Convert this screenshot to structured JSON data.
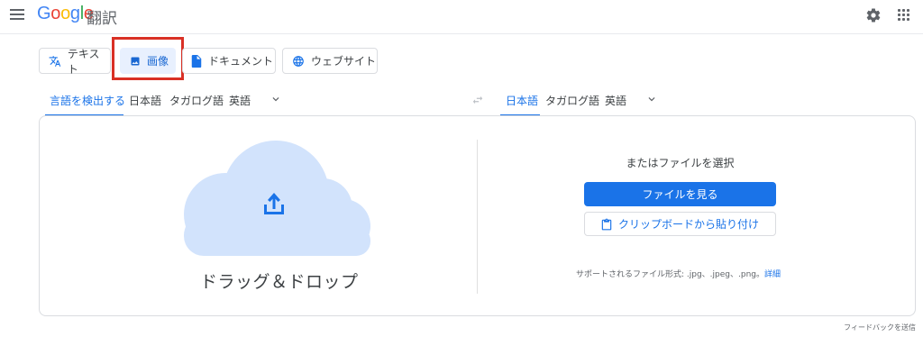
{
  "header": {
    "logo": [
      "G",
      "o",
      "o",
      "g",
      "l",
      "e"
    ],
    "product": "翻訳",
    "icons": [
      "menu-icon",
      "gear-icon",
      "apps-icon"
    ]
  },
  "modes": [
    {
      "label": "テキスト",
      "icon": "translate-icon"
    },
    {
      "label": "画像",
      "icon": "image-icon",
      "active": true
    },
    {
      "label": "ドキュメント",
      "icon": "document-icon"
    },
    {
      "label": "ウェブサイト",
      "icon": "globe-icon"
    }
  ],
  "source_langs": [
    "言語を検出する",
    "日本語",
    "タガログ語",
    "英語"
  ],
  "target_langs": [
    "日本語",
    "タガログ語",
    "英語"
  ],
  "upload": {
    "drop_label": "ドラッグ＆ドロップ",
    "or_select": "またはファイルを選択",
    "browse_button": "ファイルを見る",
    "clipboard_button": "クリップボードから貼り付け",
    "formats": "サポートされるファイル形式: .jpg、.jpeg、.png。",
    "details_link": "詳細"
  },
  "feedback": "フィードバックを送信",
  "colors": {
    "accent": "#1a73e8",
    "highlight": "#d93025",
    "cloud": "#d2e3fc"
  }
}
